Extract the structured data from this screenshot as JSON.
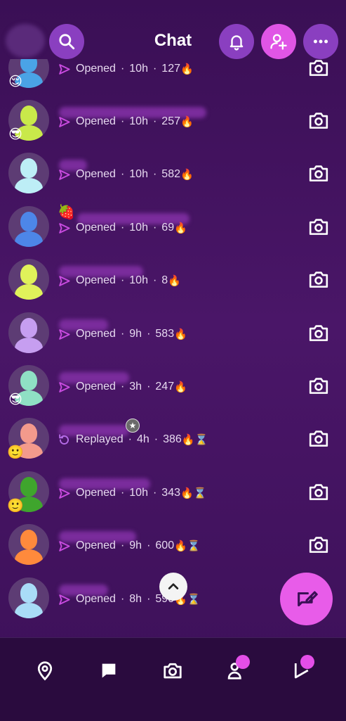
{
  "header": {
    "title": "Chat",
    "icons": [
      "search-icon",
      "bell-icon",
      "add-friend-icon",
      "more-icon"
    ]
  },
  "chats": [
    {
      "status": "Opened",
      "time": "10h",
      "streak": "127",
      "avatar_color": "#4aa3e6",
      "emoji": "😌",
      "hourglass": false,
      "name_w": 0,
      "action": "opened"
    },
    {
      "status": "Opened",
      "time": "10h",
      "streak": "257",
      "avatar_color": "#c9e94a",
      "emoji": "😎",
      "hourglass": false,
      "name_w": 210,
      "action": "opened"
    },
    {
      "status": "Opened",
      "time": "10h",
      "streak": "582",
      "avatar_color": "#bdeef6",
      "emoji": "",
      "hourglass": false,
      "name_w": 40,
      "action": "opened"
    },
    {
      "status": "Opened",
      "time": "10h",
      "streak": "69",
      "avatar_color": "#4d86e8",
      "emoji": "",
      "hourglass": false,
      "name_w": 160,
      "action": "opened",
      "prefix": "🍓"
    },
    {
      "status": "Opened",
      "time": "10h",
      "streak": "8",
      "avatar_color": "#e0f25a",
      "emoji": "",
      "hourglass": false,
      "name_w": 120,
      "action": "opened"
    },
    {
      "status": "Opened",
      "time": "9h",
      "streak": "583",
      "avatar_color": "#c69ef0",
      "emoji": "",
      "hourglass": false,
      "name_w": 70,
      "action": "opened"
    },
    {
      "status": "Opened",
      "time": "3h",
      "streak": "247",
      "avatar_color": "#8fe0c4",
      "emoji": "😎",
      "hourglass": false,
      "name_w": 100,
      "action": "opened"
    },
    {
      "status": "Replayed",
      "time": "4h",
      "streak": "386",
      "avatar_color": "#f39a8c",
      "emoji": "🙂",
      "hourglass": true,
      "name_w": 100,
      "action": "replayed",
      "star": true
    },
    {
      "status": "Opened",
      "time": "10h",
      "streak": "343",
      "avatar_color": "#3fa52d",
      "emoji": "🙂",
      "hourglass": true,
      "name_w": 130,
      "action": "opened"
    },
    {
      "status": "Opened",
      "time": "9h",
      "streak": "600",
      "avatar_color": "#ff8a3c",
      "emoji": "",
      "hourglass": true,
      "name_w": 110,
      "action": "opened"
    },
    {
      "status": "Opened",
      "time": "8h",
      "streak": "590",
      "avatar_color": "#a9dcf7",
      "emoji": "",
      "hourglass": true,
      "name_w": 70,
      "action": "opened"
    }
  ],
  "fire_icon": "🔥",
  "hourglass_icon": "⌛",
  "separator": "·",
  "nav": [
    "map-icon",
    "chat-icon",
    "camera-icon",
    "stories-icon",
    "spotlight-icon"
  ],
  "colors": {
    "accent": "#e055e6",
    "status_arrow": "#c94be0",
    "replay_icon": "#b66ce8"
  }
}
